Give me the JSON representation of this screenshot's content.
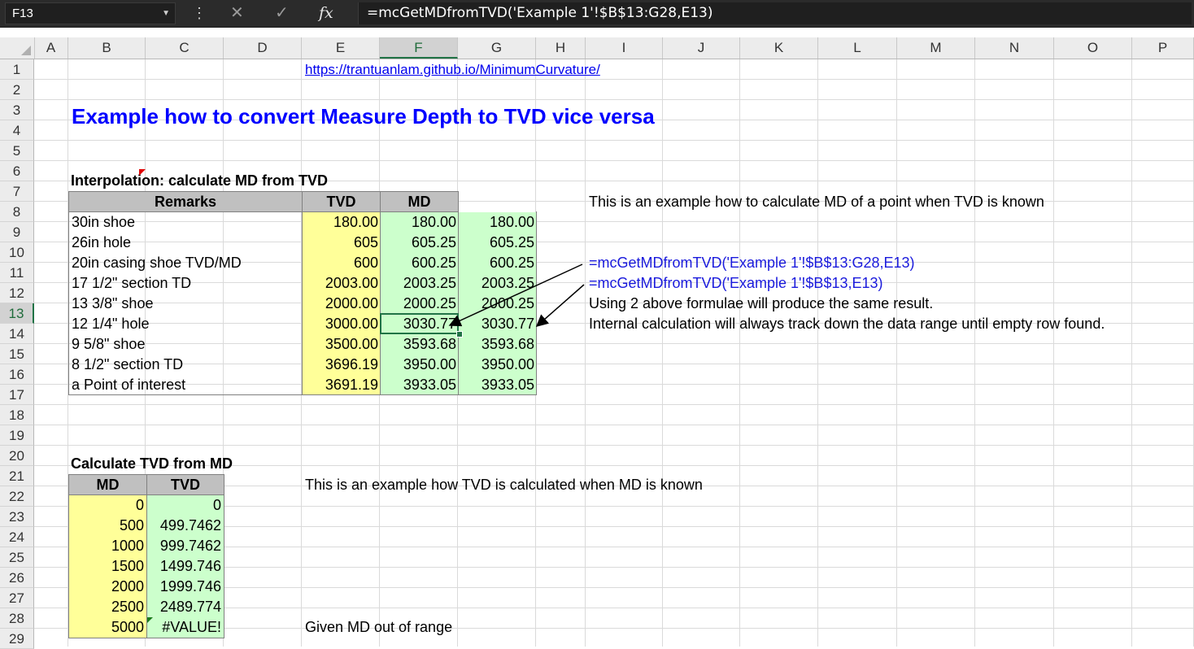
{
  "namebox": "F13",
  "formula_bar": {
    "formula": "=mcGetMDfromTVD('Example 1'!$B$13:G28,E13)"
  },
  "columns": [
    "A",
    "B",
    "C",
    "D",
    "E",
    "F",
    "G",
    "H",
    "I",
    "J",
    "K",
    "L",
    "M",
    "N",
    "O",
    "P"
  ],
  "selected_column": "F",
  "rows": [
    "1",
    "2",
    "3",
    "4",
    "5",
    "6",
    "7",
    "8",
    "9",
    "10",
    "11",
    "12",
    "13",
    "14",
    "15",
    "16",
    "17",
    "18",
    "19",
    "20",
    "21",
    "22",
    "23",
    "24",
    "25",
    "26",
    "27",
    "28",
    "29"
  ],
  "selected_row": "13",
  "link": "https://trantuanlam.github.io/MinimumCurvature/",
  "title": "Example how to convert Measure Depth to TVD vice versa",
  "section1": {
    "heading": "Interpolation: calculate MD from TVD",
    "headers": [
      "Remarks",
      "TVD",
      "MD"
    ],
    "rows": [
      {
        "remark": "30in shoe",
        "tvd": "180.00",
        "md": "180.00",
        "g": "180.00"
      },
      {
        "remark": "26in hole",
        "tvd": "605",
        "md": "605.25",
        "g": "605.25"
      },
      {
        "remark": "20in casing shoe TVD/MD",
        "tvd": "600",
        "md": "600.25",
        "g": "600.25"
      },
      {
        "remark": "17 1/2\" section TD",
        "tvd": "2003.00",
        "md": "2003.25",
        "g": "2003.25"
      },
      {
        "remark": "13 3/8\" shoe",
        "tvd": "2000.00",
        "md": "2000.25",
        "g": "2000.25"
      },
      {
        "remark": "12 1/4\" hole",
        "tvd": "3000.00",
        "md": "3030.77",
        "g": "3030.77"
      },
      {
        "remark": "9 5/8\" shoe",
        "tvd": "3500.00",
        "md": "3593.68",
        "g": "3593.68"
      },
      {
        "remark": "8 1/2\" section TD",
        "tvd": "3696.19",
        "md": "3950.00",
        "g": "3950.00"
      },
      {
        "remark": "a Point of interest",
        "tvd": "3691.19",
        "md": "3933.05",
        "g": "3933.05"
      }
    ],
    "note1": "This is an example how to calculate MD of a point when TVD is known",
    "formula1": "=mcGetMDfromTVD('Example 1'!$B$13:G28,E13)",
    "formula2": "=mcGetMDfromTVD('Example 1'!$B$13,E13)",
    "note2": "Using 2 above formulae will produce the same result.",
    "note3": "Internal calculation will always track down the data range until empty row found."
  },
  "section2": {
    "heading": "Calculate TVD from MD",
    "headers": [
      "MD",
      "TVD"
    ],
    "rows": [
      {
        "md": "0",
        "tvd": "0"
      },
      {
        "md": "500",
        "tvd": "499.7462"
      },
      {
        "md": "1000",
        "tvd": "999.7462"
      },
      {
        "md": "1500",
        "tvd": "1499.746"
      },
      {
        "md": "2000",
        "tvd": "1999.746"
      },
      {
        "md": "2500",
        "tvd": "2489.774"
      },
      {
        "md": "5000",
        "tvd": "#VALUE!"
      }
    ],
    "note1": "This is an example how TVD is calculated when MD is known",
    "note2": "Given MD out of range"
  },
  "colors": {
    "input_yellow": "#ffff99",
    "output_green": "#ccffcc",
    "header_gray": "#c0c0c0",
    "title_blue": "#0000ff",
    "selection_green": "#217346"
  }
}
